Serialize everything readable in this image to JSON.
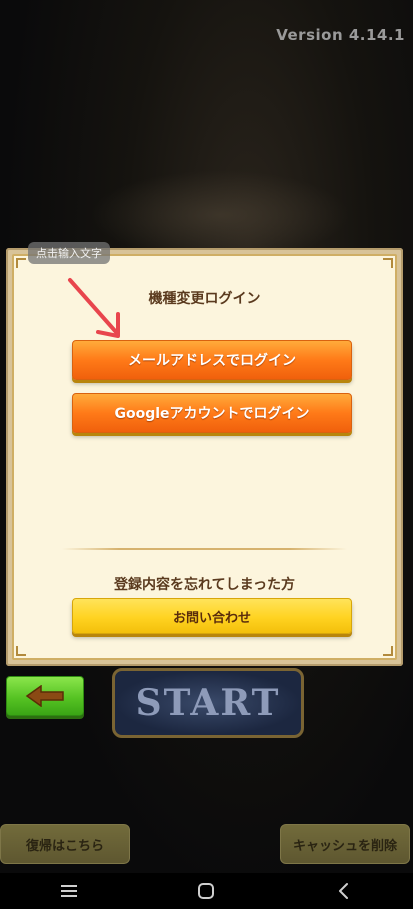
{
  "header": {
    "version": "Version  4.14.1"
  },
  "dialog": {
    "title": "機種変更ログイン",
    "mail_login_label": "メールアドレスでログイン",
    "google_login_label": "Googleアカウントでログイン",
    "forgot_label": "登録内容を忘れてしまった方",
    "contact_label": "お問い合わせ"
  },
  "overlay": {
    "hint_text": "点击输入文字"
  },
  "main": {
    "start_logo": "START"
  },
  "footer": {
    "restore_label": "復帰はこちら",
    "clear_cache_label": "キャッシュを削除"
  },
  "icons": {
    "back": "arrow-left-icon",
    "nav_menu": "menu-icon",
    "nav_home": "home-icon",
    "nav_back": "chevron-left-icon",
    "annotation": "red-arrow-icon"
  },
  "colors": {
    "orange_button": "#ff7a18",
    "yellow_button": "#ffd321",
    "green_button": "#56c323",
    "dialog_bg": "#fcf5dd",
    "annotation_arrow": "#e8454d"
  }
}
